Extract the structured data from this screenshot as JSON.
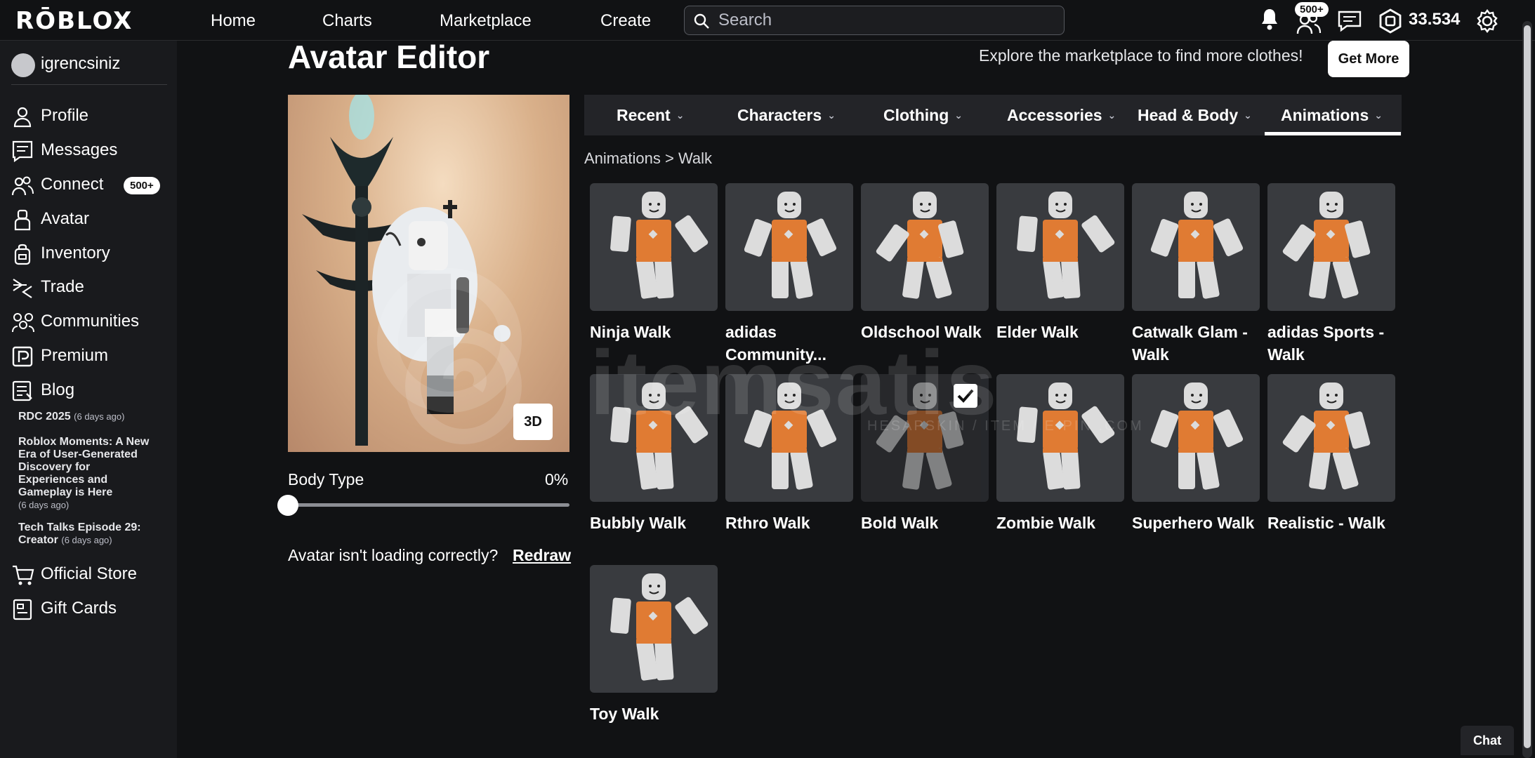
{
  "topbar": {
    "logo": "RŌBLOX",
    "nav": [
      "Home",
      "Charts",
      "Marketplace",
      "Create"
    ],
    "search_placeholder": "Search",
    "friends_badge": "500+",
    "robux": "33.534"
  },
  "sidebar": {
    "username": "igrencsiniz",
    "items": [
      {
        "label": "Profile",
        "icon": "person-icon"
      },
      {
        "label": "Messages",
        "icon": "messages-icon"
      },
      {
        "label": "Connect",
        "icon": "connect-icon",
        "badge": "500+"
      },
      {
        "label": "Avatar",
        "icon": "avatar-icon"
      },
      {
        "label": "Inventory",
        "icon": "inventory-icon"
      },
      {
        "label": "Trade",
        "icon": "trade-icon"
      },
      {
        "label": "Communities",
        "icon": "communities-icon"
      },
      {
        "label": "Premium",
        "icon": "premium-icon"
      },
      {
        "label": "Blog",
        "icon": "blog-icon"
      }
    ],
    "blog_posts": [
      {
        "title": "RDC 2025",
        "ago": "(6 days ago)"
      },
      {
        "title": "Roblox Moments: A New Era of User-Generated Discovery for Experiences and Gameplay is Here",
        "ago": "(6 days ago)"
      },
      {
        "title": "Tech Talks Episode 29: Creator",
        "ago": "(6 days ago)"
      }
    ],
    "bottom_items": [
      {
        "label": "Official Store",
        "icon": "cart-icon"
      },
      {
        "label": "Gift Cards",
        "icon": "gift-card-icon"
      }
    ]
  },
  "main": {
    "title": "Avatar Editor",
    "explore_text": "Explore the marketplace to find more clothes!",
    "get_more_label": "Get More",
    "view_3d_label": "3D",
    "body_type_label": "Body Type",
    "body_type_value": "0%",
    "body_type_level": 0,
    "not_loading_text": "Avatar isn't loading correctly?",
    "redraw_label": "Redraw"
  },
  "tabs": [
    "Recent",
    "Characters",
    "Clothing",
    "Accessories",
    "Head & Body",
    "Animations"
  ],
  "active_tab": "Animations",
  "breadcrumb": {
    "parent": "Animations",
    "separator": ">",
    "current": "Walk"
  },
  "items": [
    {
      "name": "Ninja Walk"
    },
    {
      "name": "adidas Community..."
    },
    {
      "name": "Oldschool Walk"
    },
    {
      "name": "Elder Walk"
    },
    {
      "name": "Catwalk Glam - Walk"
    },
    {
      "name": "adidas Sports - Walk"
    },
    {
      "name": "Bubbly Walk"
    },
    {
      "name": "Rthro Walk"
    },
    {
      "name": "Bold Walk",
      "selected": true
    },
    {
      "name": "Zombie Walk"
    },
    {
      "name": "Superhero Walk"
    },
    {
      "name": "Realistic - Walk"
    },
    {
      "name": "Toy Walk"
    }
  ],
  "watermark": {
    "text": "itemsatis",
    "subtext": "HESAPSKIN / ITEM / E-PIN .COM"
  },
  "chat_label": "Chat",
  "colors": {
    "background": "#111214",
    "sidebar": "#191a1d",
    "tile": "#393b3f",
    "torso": "#e07b33",
    "limb": "#dcdcdc"
  }
}
